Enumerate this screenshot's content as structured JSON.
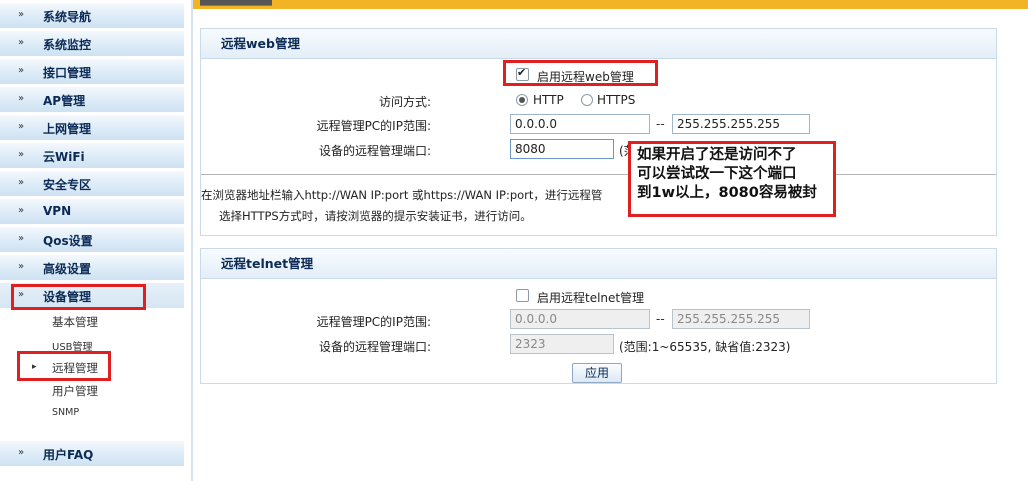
{
  "sidebar": {
    "items": [
      {
        "label": "系统导航"
      },
      {
        "label": "系统监控"
      },
      {
        "label": "接口管理"
      },
      {
        "label": "AP管理"
      },
      {
        "label": "上网管理"
      },
      {
        "label": "云WiFi"
      },
      {
        "label": "安全专区"
      },
      {
        "label": "VPN"
      },
      {
        "label": "Qos设置"
      },
      {
        "label": "高级设置"
      },
      {
        "label": "设备管理"
      }
    ],
    "sub_items": [
      {
        "label": "基本管理"
      },
      {
        "label": "USB管理"
      },
      {
        "label": "远程管理"
      },
      {
        "label": "用户管理"
      },
      {
        "label": "SNMP"
      }
    ],
    "faq": {
      "label": "用户FAQ"
    },
    "arrow_glyph": "»",
    "active_arrow_glyph": "▸"
  },
  "web_panel": {
    "title": "远程web管理",
    "enable_label": "启用远程web管理",
    "enable_checked": true,
    "access_label": "访问方式:",
    "http_label": "HTTP",
    "https_label": "HTTPS",
    "http_selected": true,
    "ip_range_label": "远程管理PC的IP范围:",
    "ip_start": "0.0.0.0",
    "ip_end": "255.255.255.255",
    "range_dash": "--",
    "port_label": "设备的远程管理端口:",
    "port_value": "8080",
    "port_hint_partial": "(范",
    "note1": "在浏览器地址栏输入http://WAN IP:port 或https://WAN IP:port，进行远程管",
    "note2": "选择HTTPS方式时，请按浏览器的提示安装证书，进行访问。"
  },
  "telnet_panel": {
    "title": "远程telnet管理",
    "enable_label": "启用远程telnet管理",
    "enable_checked": false,
    "ip_range_label": "远程管理PC的IP范围:",
    "ip_start": "0.0.0.0",
    "ip_end": "255.255.255.255",
    "range_dash": "--",
    "port_label": "设备的远程管理端口:",
    "port_value": "2323",
    "port_hint": "(范围:1~65535, 缺省值:2323)",
    "apply_label": "应用"
  },
  "annotation": {
    "line1": "如果开启了还是访问不了",
    "line2": "可以尝试改一下这个端口",
    "line3": "到1w以上，8080容易被封"
  },
  "colors": {
    "accent_bar": "#f2b425",
    "annotation_red": "#e02020",
    "menu_text": "#0b2a55"
  }
}
